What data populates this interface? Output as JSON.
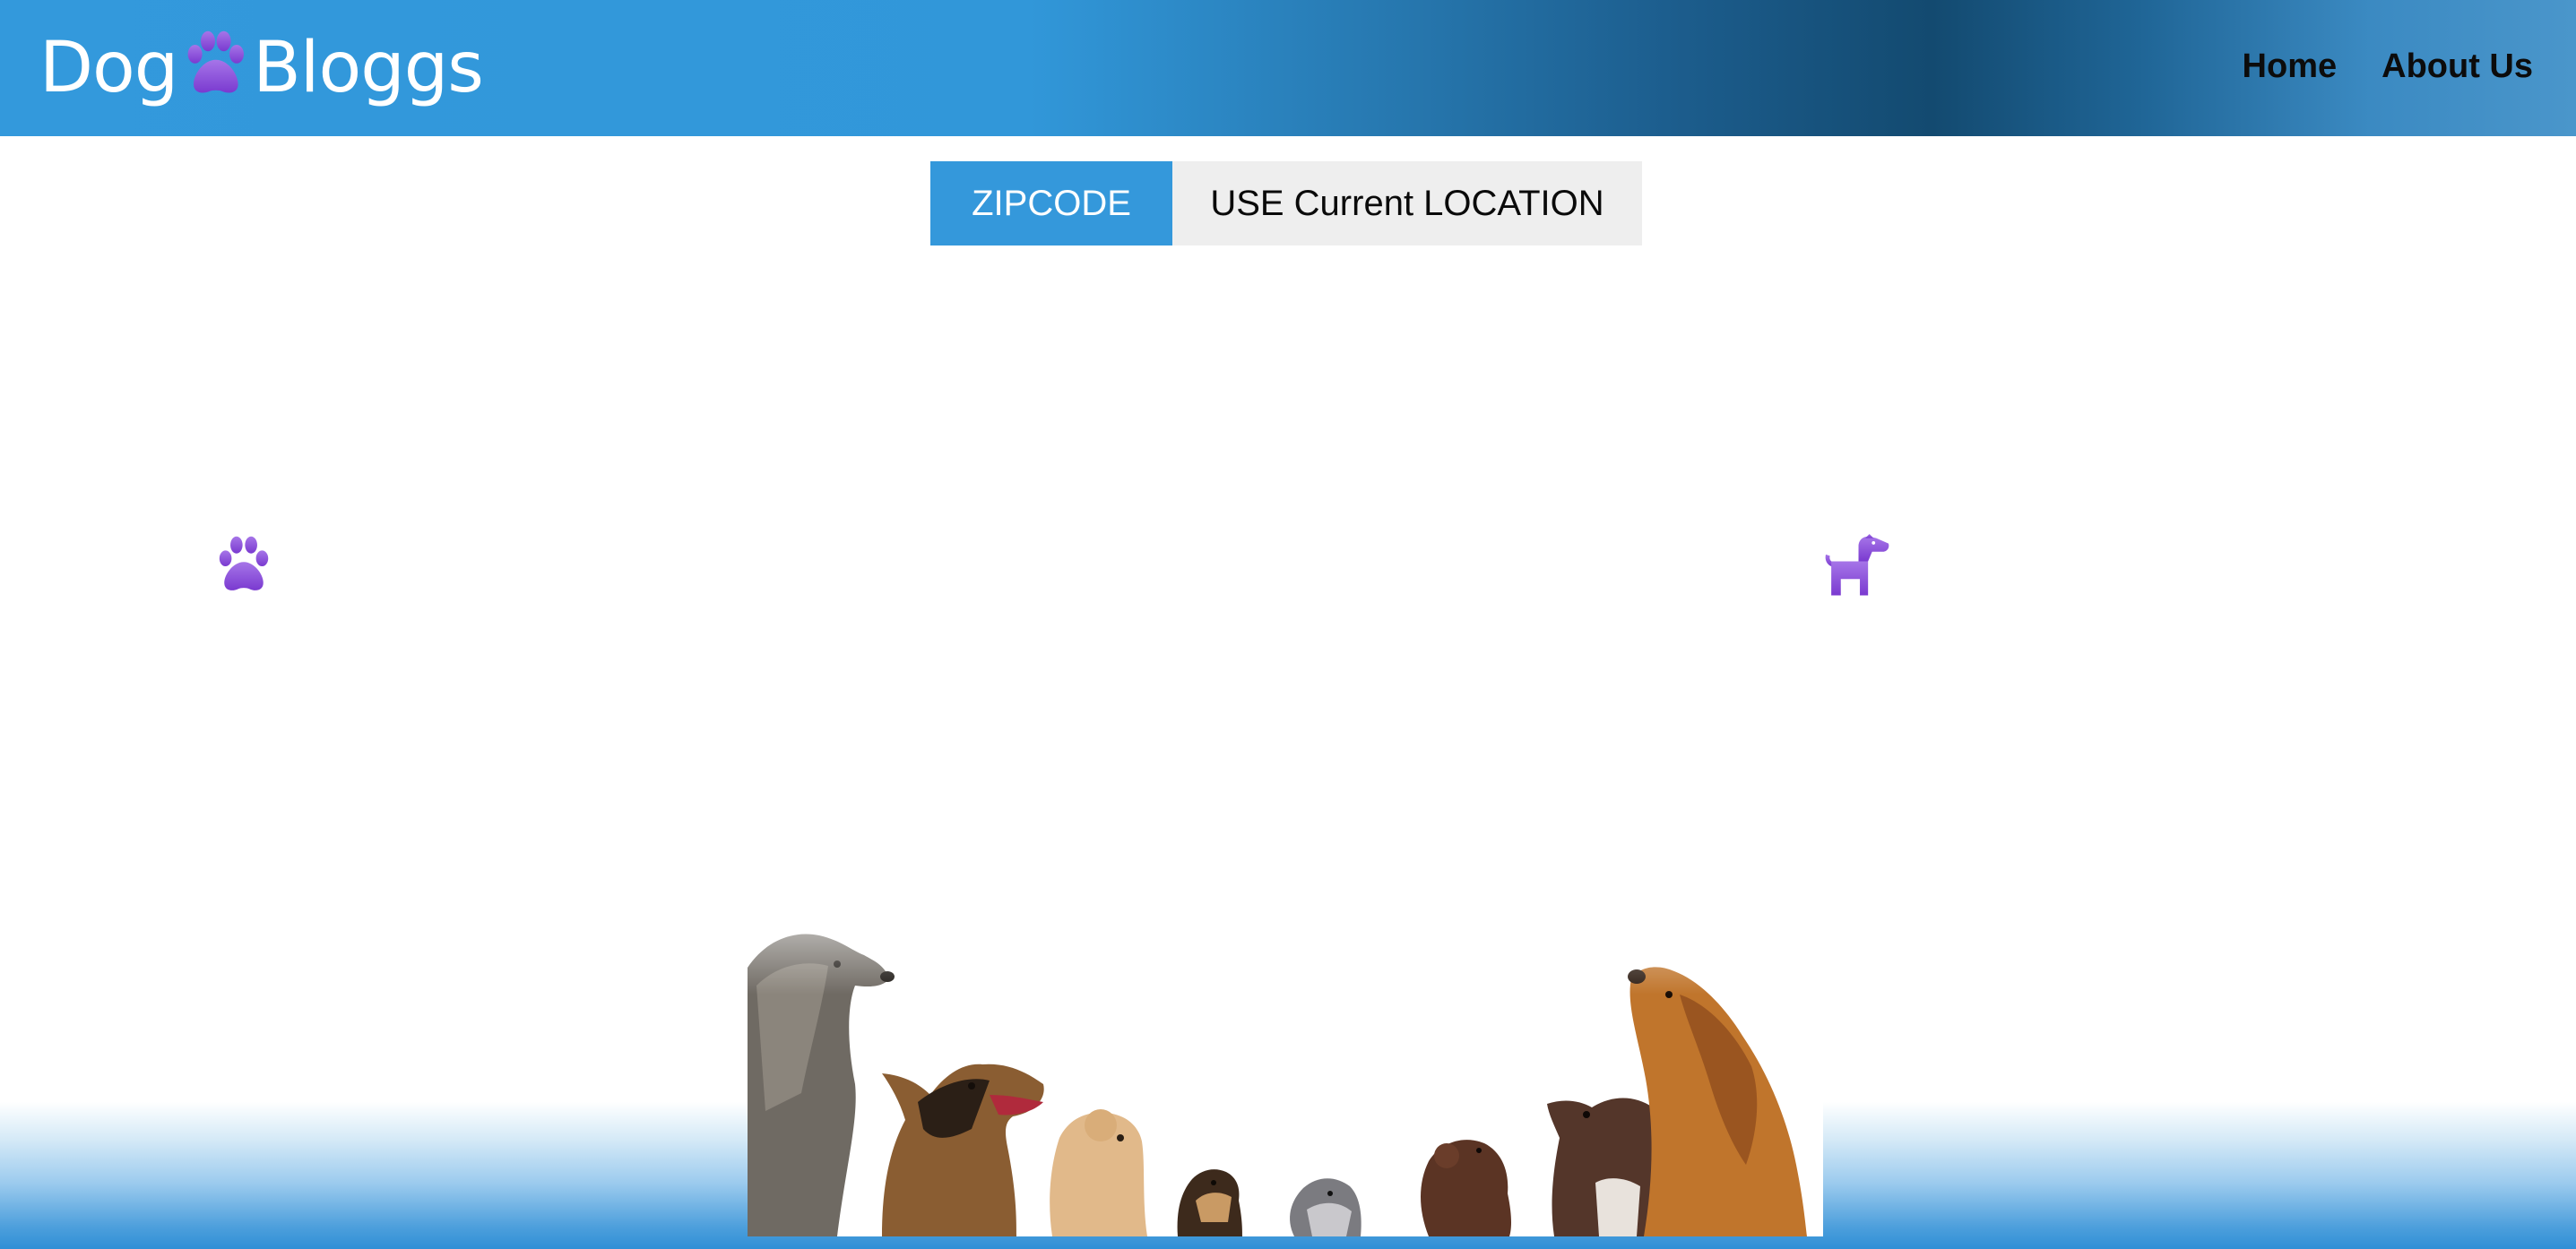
{
  "header": {
    "logo": {
      "part1": "Dog",
      "part2": "Bloggs",
      "icon": "paw-icon"
    },
    "nav": [
      {
        "label": "Home"
      },
      {
        "label": "About Us"
      }
    ]
  },
  "search_tabs": {
    "zipcode_label": "ZIPCODE",
    "location_label": "USE Current LOCATION",
    "active": "ZIPCODE"
  },
  "decor": {
    "left_icon": "paw-icon",
    "right_icon": "dog-icon"
  },
  "banner": {
    "image": "row-of-dogs-looking-up"
  },
  "colors": {
    "brand_blue": "#3498db",
    "header_dark": "#134a70",
    "accent_purple": "#8e4fd6",
    "tab_inactive_bg": "#eeeeee",
    "nav_text": "#0c0c0c"
  }
}
